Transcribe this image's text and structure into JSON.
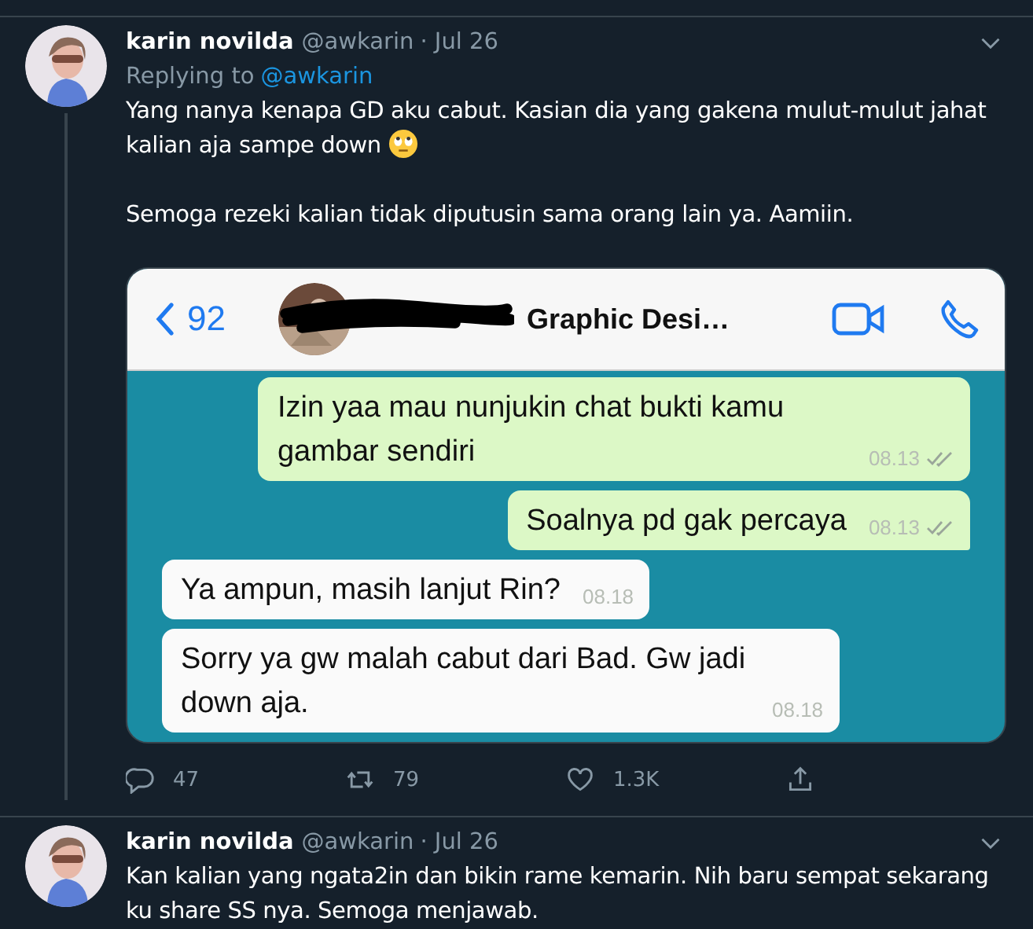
{
  "tweets": [
    {
      "author": {
        "name": "karin novilda",
        "handle": "@awkarin",
        "date": "· Jul 26"
      },
      "replying_label": "Replying to",
      "replying_to": "@awkarin",
      "thread_line": true,
      "paragraphs": [
        {
          "text": "Yang nanya kenapa GD aku cabut. Kasian dia yang gakena mulut-mulut jahat kalian aja sampe down",
          "emoji": true
        },
        {
          "text": "Semoga rezeki kalian tidak diputusin sama orang lain ya. Aamiin."
        }
      ],
      "chat": {
        "back_count": "92",
        "title": "Graphic Desi…",
        "redacted": true,
        "messages": [
          {
            "kind": "outgoing",
            "text": "Izin yaa mau nunjukin chat bukti kamu gambar sendiri",
            "time": "08.13",
            "read": true,
            "tail": false
          },
          {
            "kind": "outgoing",
            "text": "Soalnya pd gak percaya",
            "time": "08.13",
            "read": true,
            "tail": true
          },
          {
            "kind": "incoming",
            "text": "Ya ampun, masih lanjut Rin?",
            "time": "08.18",
            "read": false,
            "tail": false
          },
          {
            "kind": "incoming",
            "text": "Sorry ya gw malah cabut dari Bad. Gw jadi down aja.",
            "time": "08.18",
            "read": false,
            "tail": false
          }
        ]
      },
      "actions": [
        {
          "kind": "reply",
          "count": "47"
        },
        {
          "kind": "retweet",
          "count": "79"
        },
        {
          "kind": "like",
          "count": "1.3K"
        },
        {
          "kind": "share"
        }
      ]
    },
    {
      "author": {
        "name": "karin novilda",
        "handle": "@awkarin",
        "date": "· Jul 26"
      },
      "thread_line": false,
      "paragraphs": [
        {
          "text": "Kan kalian yang ngata2in dan bikin rame kemarin. Nih baru sempat sekarang ku share SS nya. Semoga menjawab."
        }
      ]
    }
  ]
}
